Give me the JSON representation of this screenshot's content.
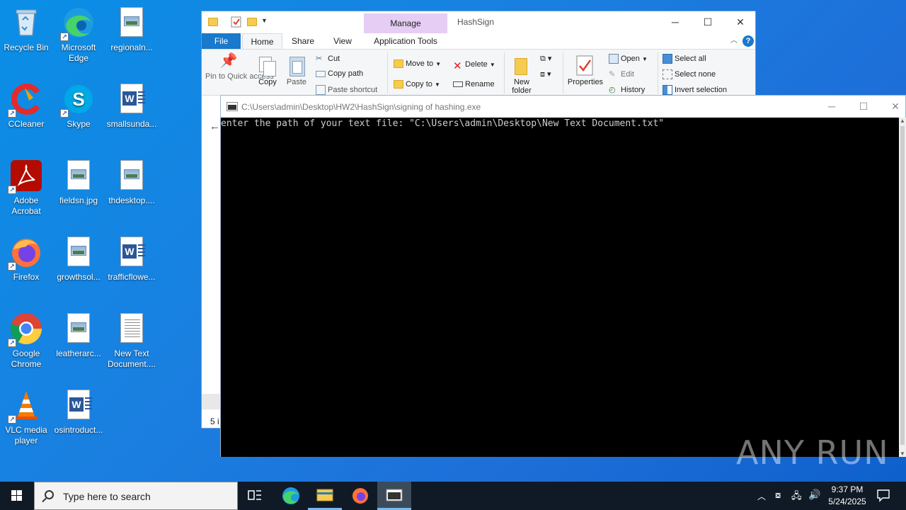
{
  "desktop": {
    "icons": [
      {
        "label": "Recycle Bin"
      },
      {
        "label": "Microsoft Edge"
      },
      {
        "label": "regionaln..."
      },
      {
        "label": "CCleaner"
      },
      {
        "label": "Skype"
      },
      {
        "label": "smallsunda..."
      },
      {
        "label": "Adobe Acrobat"
      },
      {
        "label": "fieldsn.jpg"
      },
      {
        "label": "thdesktop...."
      },
      {
        "label": "Firefox"
      },
      {
        "label": "growthsol..."
      },
      {
        "label": "trafficflowe..."
      },
      {
        "label": "Google Chrome"
      },
      {
        "label": "leatherarc..."
      },
      {
        "label": "New Text Document...."
      },
      {
        "label": "VLC media player"
      },
      {
        "label": "osintroduct..."
      }
    ]
  },
  "explorer": {
    "title": "HashSign",
    "manage_tab": "Manage",
    "tabs": {
      "file": "File",
      "home": "Home",
      "share": "Share",
      "view": "View",
      "application_tools": "Application Tools"
    },
    "ribbon": {
      "pin_to_quick_access": "Pin to Quick access",
      "copy": "Copy",
      "paste": "Paste",
      "cut": "Cut",
      "copy_path": "Copy path",
      "paste_shortcut": "Paste shortcut",
      "move_to": "Move to",
      "copy_to": "Copy to",
      "delete": "Delete",
      "rename": "Rename",
      "new_folder": "New folder",
      "properties": "Properties",
      "open": "Open",
      "edit": "Edit",
      "history": "History",
      "select_all": "Select all",
      "select_none": "Select none",
      "invert_selection": "Invert selection"
    },
    "status_text": "5 i"
  },
  "console": {
    "title": "C:\\Users\\admin\\Desktop\\HW2\\HashSign\\signing of hashing.exe",
    "output": "enter the path of your text file: \"C:\\Users\\admin\\Desktop\\New Text Document.txt\""
  },
  "watermark": "ANY RUN",
  "taskbar": {
    "search_placeholder": "Type here to search",
    "time": "9:37 PM",
    "date": "5/24/2025"
  }
}
